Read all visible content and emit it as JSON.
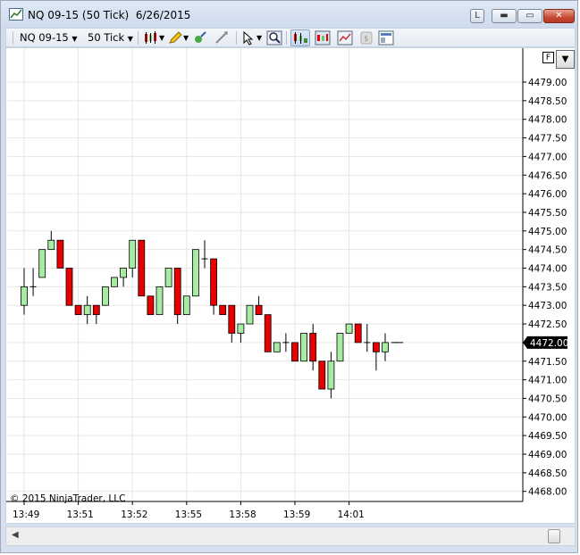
{
  "window": {
    "title": "NQ 09-15 (50 Tick)  6/26/2015",
    "buttons": {
      "link": "L",
      "minimize": "▬",
      "maximize": "▭",
      "close": "✕"
    }
  },
  "toolbar": {
    "instrument": "NQ 09-15",
    "interval": "50 Tick",
    "icons": [
      "bar-type-icon",
      "drawing-pencil-icon",
      "indicators-icon",
      "strategies-icon",
      "pointer-icon",
      "zoom-icon",
      "chart-trader-icon",
      "data-box-icon",
      "properties-icon",
      "sync-icon",
      "templates-icon"
    ]
  },
  "chart": {
    "copyright": "© 2015 NinjaTrader, LLC",
    "flag_button": "F",
    "price_labels": [
      "4479.00",
      "4478.50",
      "4478.00",
      "4477.50",
      "4477.00",
      "4476.50",
      "4476.00",
      "4475.50",
      "4475.00",
      "4474.50",
      "4474.00",
      "4473.50",
      "4473.00",
      "4472.50",
      "4472.00",
      "4471.50",
      "4471.00",
      "4470.50",
      "4470.00",
      "4469.50",
      "4469.00",
      "4468.50",
      "4468.00"
    ],
    "time_labels": [
      "13:49",
      "13:51",
      "13:52",
      "13:55",
      "13:58",
      "13:59",
      "14:01"
    ],
    "last_price": "4472.00",
    "colors": {
      "up": "#a8eca4",
      "down": "#e60000",
      "last_price_bg": "#000000",
      "grid": "#e6e6e6"
    }
  },
  "chart_data": {
    "type": "candlestick",
    "title": "NQ 09-15 (50 Tick)  6/26/2015",
    "y_range": [
      4468.0,
      4479.5
    ],
    "x_tick_labels": [
      "13:49",
      "13:51",
      "13:52",
      "13:55",
      "13:58",
      "13:59",
      "14:01"
    ],
    "ohlc": [
      {
        "o": 4473.0,
        "h": 4474.0,
        "l": 4472.75,
        "c": 4473.5
      },
      {
        "o": 4473.5,
        "h": 4474.0,
        "l": 4473.25,
        "c": 4473.5
      },
      {
        "o": 4473.75,
        "h": 4474.5,
        "l": 4473.75,
        "c": 4474.5
      },
      {
        "o": 4474.5,
        "h": 4475.0,
        "l": 4474.5,
        "c": 4474.75
      },
      {
        "o": 4474.75,
        "h": 4474.75,
        "l": 4474.0,
        "c": 4474.0
      },
      {
        "o": 4474.0,
        "h": 4474.0,
        "l": 4473.0,
        "c": 4473.0
      },
      {
        "o": 4473.0,
        "h": 4473.0,
        "l": 4472.75,
        "c": 4472.75
      },
      {
        "o": 4472.75,
        "h": 4473.25,
        "l": 4472.5,
        "c": 4473.0
      },
      {
        "o": 4473.0,
        "h": 4473.0,
        "l": 4472.5,
        "c": 4472.75
      },
      {
        "o": 4473.0,
        "h": 4473.5,
        "l": 4473.0,
        "c": 4473.5
      },
      {
        "o": 4473.5,
        "h": 4473.75,
        "l": 4473.5,
        "c": 4473.75
      },
      {
        "o": 4473.75,
        "h": 4474.0,
        "l": 4473.5,
        "c": 4474.0
      },
      {
        "o": 4474.0,
        "h": 4474.75,
        "l": 4473.75,
        "c": 4474.75
      },
      {
        "o": 4474.75,
        "h": 4474.75,
        "l": 4473.25,
        "c": 4473.25
      },
      {
        "o": 4473.25,
        "h": 4473.25,
        "l": 4472.75,
        "c": 4472.75
      },
      {
        "o": 4472.75,
        "h": 4473.5,
        "l": 4472.75,
        "c": 4473.5
      },
      {
        "o": 4473.5,
        "h": 4474.0,
        "l": 4473.5,
        "c": 4474.0
      },
      {
        "o": 4474.0,
        "h": 4474.0,
        "l": 4472.5,
        "c": 4472.75
      },
      {
        "o": 4472.75,
        "h": 4473.25,
        "l": 4472.75,
        "c": 4473.25
      },
      {
        "o": 4473.25,
        "h": 4474.5,
        "l": 4473.25,
        "c": 4474.5
      },
      {
        "o": 4474.25,
        "h": 4474.75,
        "l": 4474.0,
        "c": 4474.25
      },
      {
        "o": 4474.25,
        "h": 4474.25,
        "l": 4472.75,
        "c": 4473.0
      },
      {
        "o": 4473.0,
        "h": 4473.0,
        "l": 4472.75,
        "c": 4472.75
      },
      {
        "o": 4473.0,
        "h": 4473.0,
        "l": 4472.0,
        "c": 4472.25
      },
      {
        "o": 4472.25,
        "h": 4472.5,
        "l": 4472.0,
        "c": 4472.5
      },
      {
        "o": 4472.5,
        "h": 4473.0,
        "l": 4472.5,
        "c": 4473.0
      },
      {
        "o": 4473.0,
        "h": 4473.25,
        "l": 4472.75,
        "c": 4472.75
      },
      {
        "o": 4472.75,
        "h": 4472.75,
        "l": 4471.75,
        "c": 4471.75
      },
      {
        "o": 4471.75,
        "h": 4472.0,
        "l": 4471.75,
        "c": 4472.0
      },
      {
        "o": 4472.0,
        "h": 4472.25,
        "l": 4471.75,
        "c": 4472.0
      },
      {
        "o": 4472.0,
        "h": 4472.0,
        "l": 4471.5,
        "c": 4471.5
      },
      {
        "o": 4471.5,
        "h": 4472.25,
        "l": 4471.5,
        "c": 4472.25
      },
      {
        "o": 4472.25,
        "h": 4472.5,
        "l": 4471.25,
        "c": 4471.5
      },
      {
        "o": 4471.5,
        "h": 4471.5,
        "l": 4470.75,
        "c": 4470.75
      },
      {
        "o": 4470.75,
        "h": 4471.75,
        "l": 4470.5,
        "c": 4471.5
      },
      {
        "o": 4471.5,
        "h": 4472.25,
        "l": 4471.5,
        "c": 4472.25
      },
      {
        "o": 4472.25,
        "h": 4472.5,
        "l": 4472.25,
        "c": 4472.5
      },
      {
        "o": 4472.5,
        "h": 4472.5,
        "l": 4472.0,
        "c": 4472.0
      },
      {
        "o": 4472.0,
        "h": 4472.5,
        "l": 4471.75,
        "c": 4472.0
      },
      {
        "o": 4472.0,
        "h": 4472.0,
        "l": 4471.25,
        "c": 4471.75
      },
      {
        "o": 4471.75,
        "h": 4472.25,
        "l": 4471.5,
        "c": 4472.0
      },
      {
        "o": 4472.0,
        "h": 4472.0,
        "l": 4472.0,
        "c": 4472.0
      }
    ]
  }
}
